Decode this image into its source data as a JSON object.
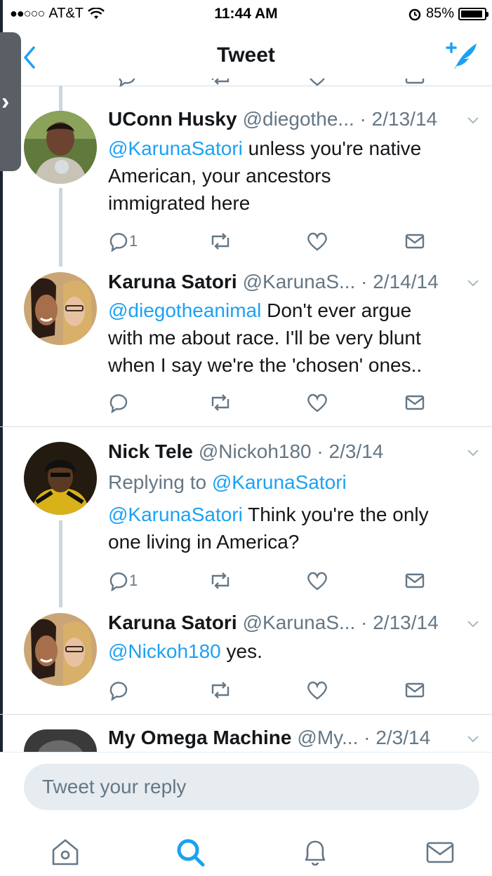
{
  "status_bar": {
    "signal": "●●○○○",
    "carrier": "AT&T",
    "time": "11:44 AM",
    "battery": "85%"
  },
  "nav": {
    "title": "Tweet"
  },
  "tweets": [
    {
      "name": "UConn Husky",
      "handle": "@diegothe...",
      "date": "2/13/14",
      "mention": "@KarunaSatori",
      "lines": [
        " unless you're native",
        "American, your ancestors",
        "immigrated here"
      ],
      "reply_count": "1"
    },
    {
      "name": "Karuna Satori",
      "handle": "@KarunaS...",
      "date": "2/14/14",
      "mention": "@diegotheanimal",
      "lines": [
        " Don't ever argue",
        "with me about race. I'll be very blunt",
        "when I say we're the 'chosen' ones.."
      ],
      "reply_count": ""
    },
    {
      "name": "Nick Tele",
      "handle": "@Nickoh180",
      "date": "2/3/14",
      "replying_label": "Replying to",
      "replying_to": "@KarunaSatori",
      "mention": "@KarunaSatori",
      "lines": [
        " Think you're the only",
        "one living in America?"
      ],
      "reply_count": "1"
    },
    {
      "name": "Karuna Satori",
      "handle": "@KarunaS...",
      "date": "2/13/14",
      "mention": "@Nickoh180",
      "lines": [
        " yes."
      ],
      "reply_count": ""
    },
    {
      "name": "My Omega Machine",
      "handle": "@My...",
      "date": "2/3/14"
    }
  ],
  "reply": {
    "placeholder": "Tweet your reply"
  },
  "icons": {
    "back": "chevron-left-icon",
    "compose": "compose-tweet-icon",
    "home": "home-icon",
    "search": "search-icon",
    "notifications": "bell-icon",
    "messages": "mail-icon"
  },
  "colors": {
    "accent": "#1da1f2",
    "muted": "#657786",
    "text": "#14171a"
  }
}
